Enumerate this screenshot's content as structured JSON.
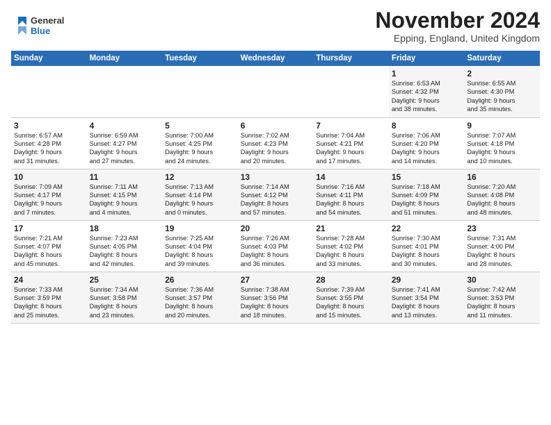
{
  "logo": {
    "general": "General",
    "blue": "Blue"
  },
  "title": "November 2024",
  "location": "Epping, England, United Kingdom",
  "days_of_week": [
    "Sunday",
    "Monday",
    "Tuesday",
    "Wednesday",
    "Thursday",
    "Friday",
    "Saturday"
  ],
  "weeks": [
    [
      {
        "day": "",
        "info": ""
      },
      {
        "day": "",
        "info": ""
      },
      {
        "day": "",
        "info": ""
      },
      {
        "day": "",
        "info": ""
      },
      {
        "day": "",
        "info": ""
      },
      {
        "day": "1",
        "info": "Sunrise: 6:53 AM\nSunset: 4:32 PM\nDaylight: 9 hours\nand 38 minutes."
      },
      {
        "day": "2",
        "info": "Sunrise: 6:55 AM\nSunset: 4:30 PM\nDaylight: 9 hours\nand 35 minutes."
      }
    ],
    [
      {
        "day": "3",
        "info": "Sunrise: 6:57 AM\nSunset: 4:28 PM\nDaylight: 9 hours\nand 31 minutes."
      },
      {
        "day": "4",
        "info": "Sunrise: 6:59 AM\nSunset: 4:27 PM\nDaylight: 9 hours\nand 27 minutes."
      },
      {
        "day": "5",
        "info": "Sunrise: 7:00 AM\nSunset: 4:25 PM\nDaylight: 9 hours\nand 24 minutes."
      },
      {
        "day": "6",
        "info": "Sunrise: 7:02 AM\nSunset: 4:23 PM\nDaylight: 9 hours\nand 20 minutes."
      },
      {
        "day": "7",
        "info": "Sunrise: 7:04 AM\nSunset: 4:21 PM\nDaylight: 9 hours\nand 17 minutes."
      },
      {
        "day": "8",
        "info": "Sunrise: 7:06 AM\nSunset: 4:20 PM\nDaylight: 9 hours\nand 14 minutes."
      },
      {
        "day": "9",
        "info": "Sunrise: 7:07 AM\nSunset: 4:18 PM\nDaylight: 9 hours\nand 10 minutes."
      }
    ],
    [
      {
        "day": "10",
        "info": "Sunrise: 7:09 AM\nSunset: 4:17 PM\nDaylight: 9 hours\nand 7 minutes."
      },
      {
        "day": "11",
        "info": "Sunrise: 7:11 AM\nSunset: 4:15 PM\nDaylight: 9 hours\nand 4 minutes."
      },
      {
        "day": "12",
        "info": "Sunrise: 7:13 AM\nSunset: 4:14 PM\nDaylight: 9 hours\nand 0 minutes."
      },
      {
        "day": "13",
        "info": "Sunrise: 7:14 AM\nSunset: 4:12 PM\nDaylight: 8 hours\nand 57 minutes."
      },
      {
        "day": "14",
        "info": "Sunrise: 7:16 AM\nSunset: 4:11 PM\nDaylight: 8 hours\nand 54 minutes."
      },
      {
        "day": "15",
        "info": "Sunrise: 7:18 AM\nSunset: 4:09 PM\nDaylight: 8 hours\nand 51 minutes."
      },
      {
        "day": "16",
        "info": "Sunrise: 7:20 AM\nSunset: 4:08 PM\nDaylight: 8 hours\nand 48 minutes."
      }
    ],
    [
      {
        "day": "17",
        "info": "Sunrise: 7:21 AM\nSunset: 4:07 PM\nDaylight: 8 hours\nand 45 minutes."
      },
      {
        "day": "18",
        "info": "Sunrise: 7:23 AM\nSunset: 4:05 PM\nDaylight: 8 hours\nand 42 minutes."
      },
      {
        "day": "19",
        "info": "Sunrise: 7:25 AM\nSunset: 4:04 PM\nDaylight: 8 hours\nand 39 minutes."
      },
      {
        "day": "20",
        "info": "Sunrise: 7:26 AM\nSunset: 4:03 PM\nDaylight: 8 hours\nand 36 minutes."
      },
      {
        "day": "21",
        "info": "Sunrise: 7:28 AM\nSunset: 4:02 PM\nDaylight: 8 hours\nand 33 minutes."
      },
      {
        "day": "22",
        "info": "Sunrise: 7:30 AM\nSunset: 4:01 PM\nDaylight: 8 hours\nand 30 minutes."
      },
      {
        "day": "23",
        "info": "Sunrise: 7:31 AM\nSunset: 4:00 PM\nDaylight: 8 hours\nand 28 minutes."
      }
    ],
    [
      {
        "day": "24",
        "info": "Sunrise: 7:33 AM\nSunset: 3:59 PM\nDaylight: 8 hours\nand 25 minutes."
      },
      {
        "day": "25",
        "info": "Sunrise: 7:34 AM\nSunset: 3:58 PM\nDaylight: 8 hours\nand 23 minutes."
      },
      {
        "day": "26",
        "info": "Sunrise: 7:36 AM\nSunset: 3:57 PM\nDaylight: 8 hours\nand 20 minutes."
      },
      {
        "day": "27",
        "info": "Sunrise: 7:38 AM\nSunset: 3:56 PM\nDaylight: 8 hours\nand 18 minutes."
      },
      {
        "day": "28",
        "info": "Sunrise: 7:39 AM\nSunset: 3:55 PM\nDaylight: 8 hours\nand 15 minutes."
      },
      {
        "day": "29",
        "info": "Sunrise: 7:41 AM\nSunset: 3:54 PM\nDaylight: 8 hours\nand 13 minutes."
      },
      {
        "day": "30",
        "info": "Sunrise: 7:42 AM\nSunset: 3:53 PM\nDaylight: 8 hours\nand 11 minutes."
      }
    ]
  ]
}
